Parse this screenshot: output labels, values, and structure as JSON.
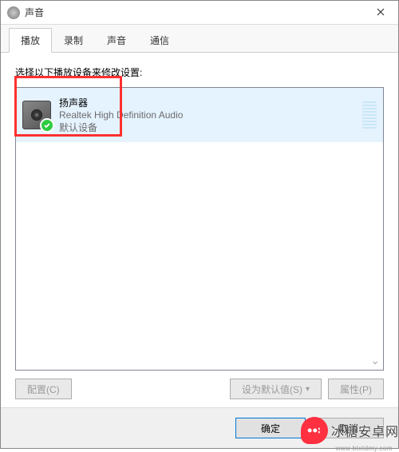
{
  "window": {
    "title": "声音"
  },
  "tabs": [
    {
      "label": "播放",
      "active": true
    },
    {
      "label": "录制",
      "active": false
    },
    {
      "label": "声音",
      "active": false
    },
    {
      "label": "通信",
      "active": false
    }
  ],
  "instruction": "选择以下播放设备来修改设置:",
  "devices": [
    {
      "name": "扬声器",
      "driver": "Realtek High Definition Audio",
      "status": "默认设备",
      "default": true
    }
  ],
  "buttons": {
    "configure": "配置(C)",
    "setDefault": "设为默认值(S)",
    "properties": "属性(P)",
    "ok": "确定",
    "cancel": "取消"
  },
  "watermark": {
    "text": "冰糖安卓网",
    "url": "www.btxtdmy.com"
  }
}
